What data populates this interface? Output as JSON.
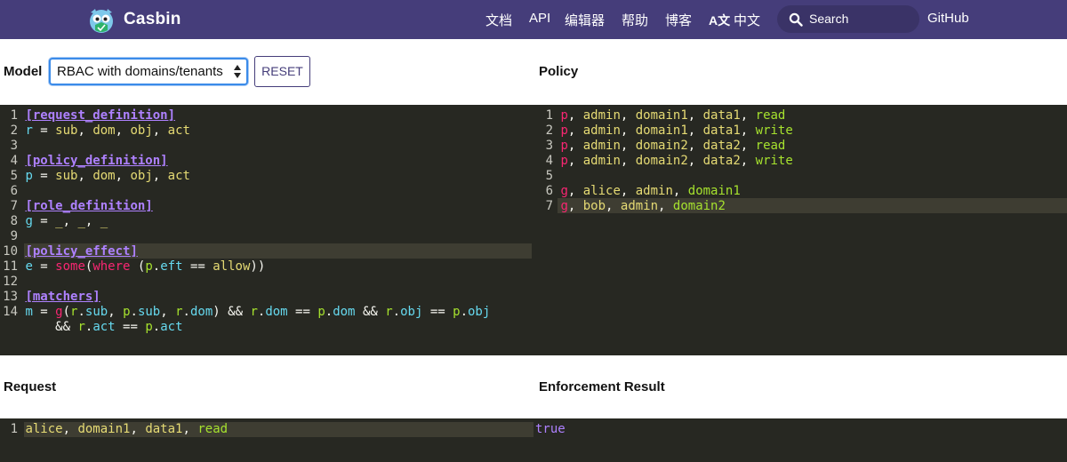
{
  "nav": {
    "brand": "Casbin",
    "items": [
      {
        "label": "文档"
      },
      {
        "label": "API"
      },
      {
        "label": "编辑器"
      },
      {
        "label": "帮助"
      },
      {
        "label": "博客"
      }
    ],
    "lang_icon": "A文",
    "lang_label": "中文",
    "search_placeholder": "Search",
    "github": "GitHub"
  },
  "model": {
    "label": "Model",
    "select_value": "RBAC with domains/tenants",
    "reset": "RESET"
  },
  "policy": {
    "label": "Policy"
  },
  "request": {
    "label": "Request"
  },
  "result": {
    "label": "Enforcement Result",
    "value": "true"
  },
  "model_editor": {
    "gutter": [
      "1",
      "2",
      "3",
      "4",
      "5",
      "6",
      "7",
      "8",
      "9",
      "10",
      "11",
      "12",
      "13",
      "14",
      ""
    ],
    "l1": "[request_definition]",
    "l2": [
      "r",
      " = ",
      "sub",
      ", ",
      "dom",
      ", ",
      "obj",
      ", ",
      "act"
    ],
    "l4": "[policy_definition]",
    "l5": [
      "p",
      " = ",
      "sub",
      ", ",
      "dom",
      ", ",
      "obj",
      ", ",
      "act"
    ],
    "l7": "[role_definition]",
    "l8": [
      "g",
      " = ",
      "_",
      ", ",
      "_",
      ", ",
      "_"
    ],
    "l10": "[policy_effect]",
    "l11": [
      "e",
      " = ",
      "some",
      "(",
      "where",
      " (",
      "p",
      ".",
      "eft",
      " == ",
      "allow",
      "))"
    ],
    "l13": "[matchers]",
    "l14": [
      "m",
      " = ",
      "g",
      "(",
      "r",
      ".",
      "sub",
      ", ",
      "p",
      ".",
      "sub",
      ", ",
      "r",
      ".",
      "dom",
      ") ",
      "&&",
      " ",
      "r",
      ".",
      "dom",
      " == ",
      "p",
      ".",
      "dom",
      " ",
      "&&",
      " ",
      "r",
      ".",
      "obj",
      " == ",
      "p",
      ".",
      "obj"
    ],
    "l15": [
      "&&",
      " ",
      "r",
      ".",
      "act",
      " == ",
      "p",
      ".",
      "act"
    ]
  },
  "policy_editor": {
    "gutter": [
      "1",
      "2",
      "3",
      "4",
      "5",
      "6",
      "7"
    ],
    "rows": [
      [
        "p",
        "admin",
        "domain1",
        "data1",
        "read"
      ],
      [
        "p",
        "admin",
        "domain1",
        "data1",
        "write"
      ],
      [
        "p",
        "admin",
        "domain2",
        "data2",
        "read"
      ],
      [
        "p",
        "admin",
        "domain2",
        "data2",
        "write"
      ],
      [],
      [
        "g",
        "alice",
        "admin",
        "domain1"
      ],
      [
        "g",
        "bob",
        "admin",
        "domain2"
      ]
    ]
  },
  "request_editor": {
    "gutter": "1",
    "values": [
      "alice",
      "domain1",
      "data1",
      "read"
    ]
  },
  "colors": {
    "navbar": "#453d7a",
    "editor_bg": "#272822",
    "keyword": "#ae81ff",
    "variable": "#66d9ef",
    "string": "#e6db74",
    "green": "#a6e22e",
    "red": "#f92672"
  }
}
